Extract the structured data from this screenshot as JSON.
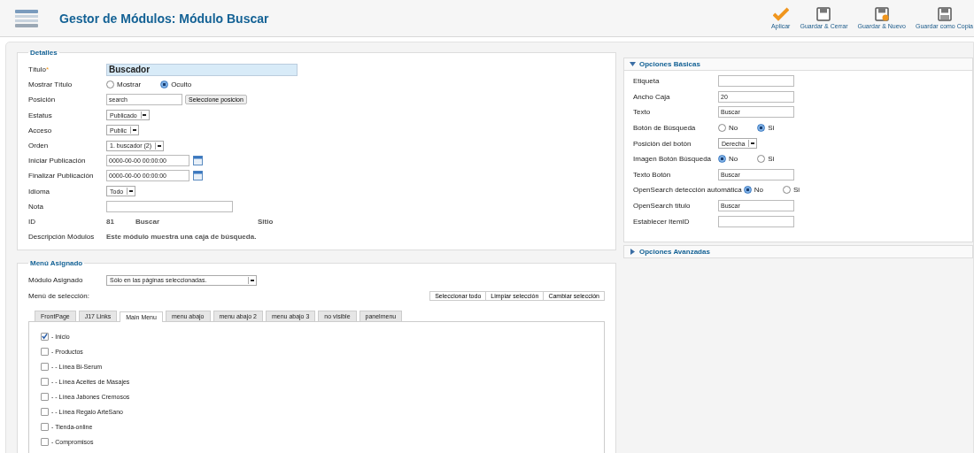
{
  "header": {
    "title": "Gestor de Módulos: Módulo Buscar"
  },
  "toolbar": [
    {
      "kind": "apply",
      "label": "Aplicar"
    },
    {
      "kind": "save",
      "label": "Guardar & Cerrar"
    },
    {
      "kind": "save-new",
      "label": "Guardar & Nuevo"
    },
    {
      "kind": "save-copy",
      "label": "Guardar como Copia"
    }
  ],
  "details": {
    "legend": "Detalles",
    "rows": [
      {
        "kind": "title",
        "label": "Título",
        "required_mark": "*",
        "value": "Buscador"
      },
      {
        "kind": "radio",
        "label": "Mostrar Título",
        "options": [
          {
            "label": "Mostrar",
            "selected": false
          },
          {
            "label": "Oculto",
            "selected": true
          }
        ]
      },
      {
        "kind": "input-button",
        "label": "Posición",
        "value": "search",
        "button": "Seleccione posicion"
      },
      {
        "kind": "select",
        "label": "Estatus",
        "value": "Publicado"
      },
      {
        "kind": "select",
        "label": "Acceso",
        "value": "Public"
      },
      {
        "kind": "select",
        "label": "Orden",
        "value": "1. buscador (2)"
      },
      {
        "kind": "date",
        "label": "Iniciar Publicación",
        "value": "0000-00-00 00:00:00"
      },
      {
        "kind": "date",
        "label": "Finalizar Publicación",
        "value": "0000-00-00 00:00:00"
      },
      {
        "kind": "select",
        "label": "Idioma",
        "value": "Todo"
      },
      {
        "kind": "input",
        "label": "Nota"
      },
      {
        "kind": "static",
        "label": "ID",
        "values": [
          "81",
          "Buscar",
          "Sitio"
        ]
      },
      {
        "kind": "static",
        "label": "Descripción Módulos",
        "values": [
          "Este módulo muestra una caja de búsqueda."
        ]
      }
    ]
  },
  "options": [
    {
      "title": "Opciones Básicas",
      "expanded": true,
      "rows": [
        {
          "kind": "input",
          "label": "Etiqueta"
        },
        {
          "kind": "input",
          "label": "Ancho Caja",
          "value": "20"
        },
        {
          "kind": "input",
          "label": "Texto",
          "value": "Buscar"
        },
        {
          "kind": "radio",
          "label": "Botón de Búsqueda",
          "options": [
            {
              "label": "No",
              "selected": false
            },
            {
              "label": "Si",
              "selected": true
            }
          ]
        },
        {
          "kind": "select",
          "label": "Posición del botón",
          "value": "Derecha"
        },
        {
          "kind": "radio",
          "label": "Imagen Botón Búsqueda",
          "options": [
            {
              "label": "No",
              "selected": true
            },
            {
              "label": "Si",
              "selected": false
            }
          ]
        },
        {
          "kind": "input",
          "label": "Texto Botón",
          "value": "Buscar"
        },
        {
          "kind": "radio",
          "label": "OpenSearch detección automática",
          "options": [
            {
              "label": "No",
              "selected": true
            },
            {
              "label": "Si",
              "selected": false
            }
          ]
        },
        {
          "kind": "input",
          "label": "OpenSearch título",
          "value": "Buscar"
        },
        {
          "kind": "input",
          "label": "Establecer ItemID"
        }
      ]
    },
    {
      "title": "Opciones Avanzadas",
      "expanded": false
    }
  ],
  "menu": {
    "legend": "Menú Asignado",
    "assigned_label": "Módulo Asignado",
    "assigned_value": "Sólo en las páginas seleccionadas.",
    "selection_label": "Menú de selección:",
    "buttons": [
      "Seleccionar todo",
      "Limpiar selección",
      "Cambiar selección"
    ],
    "tabs": [
      {
        "label": "FrontPage",
        "selected": false
      },
      {
        "label": "J17 Links",
        "selected": false
      },
      {
        "label": "Main Menu",
        "selected": true
      },
      {
        "label": "menu abajo",
        "selected": false
      },
      {
        "label": "menu abajo 2",
        "selected": false
      },
      {
        "label": "menu abajo 3",
        "selected": false
      },
      {
        "label": "no visible",
        "selected": false
      },
      {
        "label": "panelmenu",
        "selected": false
      }
    ],
    "items": [
      {
        "label": "- Inicio",
        "checked": true
      },
      {
        "label": "- Productos",
        "checked": false
      },
      {
        "label": "- - Línea Bi-Serum",
        "checked": false
      },
      {
        "label": "- - Línea Aceites de Masajes",
        "checked": false
      },
      {
        "label": "- - Línea Jabones Cremosos",
        "checked": false
      },
      {
        "label": "- - Línea Regalo ArteSano",
        "checked": false
      },
      {
        "label": "- Tienda-online",
        "checked": false
      },
      {
        "label": "- Compromisos",
        "checked": false
      }
    ]
  }
}
